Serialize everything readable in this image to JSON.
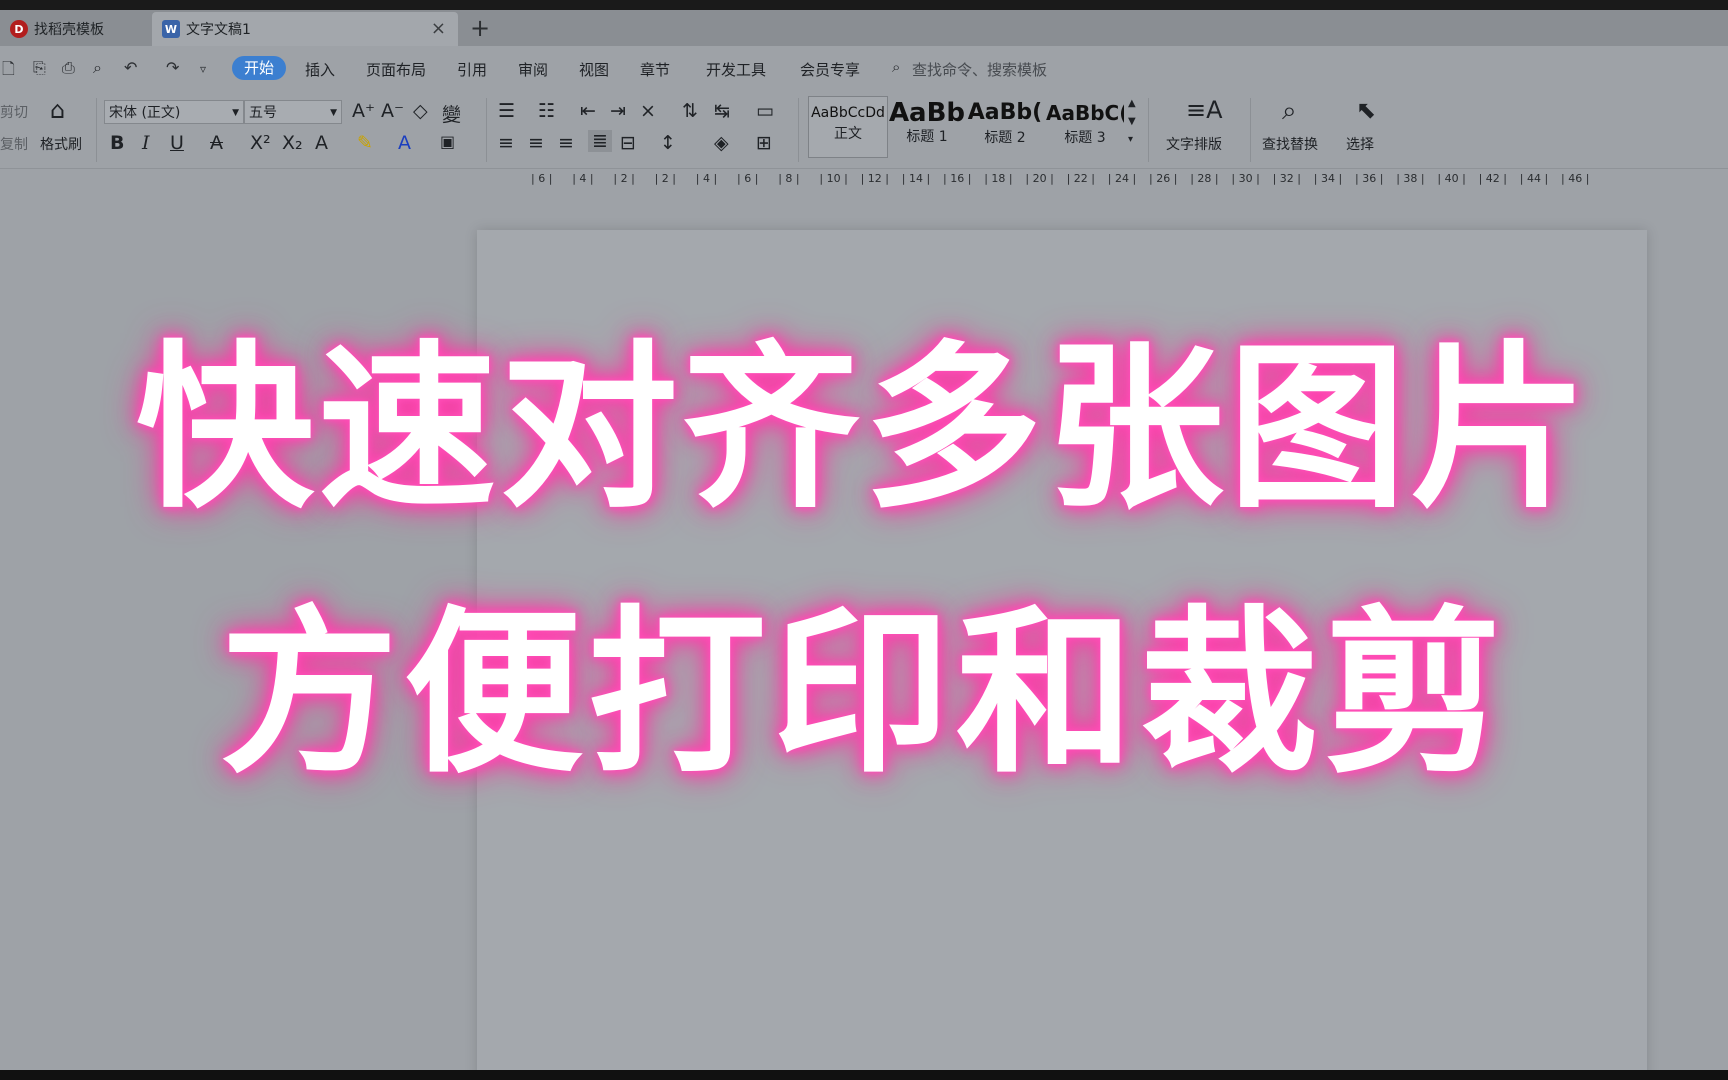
{
  "tabs": [
    {
      "label": "找稻壳模板",
      "icon": "docer-logo-icon"
    },
    {
      "label": "文字文稿1",
      "icon": "wps-writer-icon"
    }
  ],
  "tab_close": "×",
  "tab_add": "+",
  "menu": {
    "active": "开始",
    "items": [
      "插入",
      "页面布局",
      "引用",
      "审阅",
      "视图",
      "章节",
      "开发工具",
      "会员专享"
    ],
    "search_placeholder": "查找命令、搜索模板"
  },
  "ribbon": {
    "cut": "剪切",
    "copy": "复制",
    "format_painter": "格式刷",
    "font_name": "宋体 (正文)",
    "font_size": "五号",
    "styles": [
      {
        "preview": "AaBbCcDd",
        "label": "正文"
      },
      {
        "preview": "AaBb",
        "label": "标题 1"
      },
      {
        "preview": "AaBb(",
        "label": "标题 2"
      },
      {
        "preview": "AaBbC(",
        "label": "标题 3"
      }
    ],
    "text_layout": "文字排版",
    "find_replace": "查找替换",
    "select": "选择"
  },
  "ruler_ticks": [
    "6",
    "4",
    "2",
    "2",
    "4",
    "6",
    "8",
    "10",
    "12",
    "14",
    "16",
    "18",
    "20",
    "22",
    "24",
    "26",
    "28",
    "30",
    "32",
    "34",
    "36",
    "38",
    "40",
    "42",
    "44",
    "46"
  ],
  "overlay": {
    "line1": "快速对齐多张图片",
    "line2": "方便打印和裁剪",
    "glow_color": "#ff4fb8"
  }
}
